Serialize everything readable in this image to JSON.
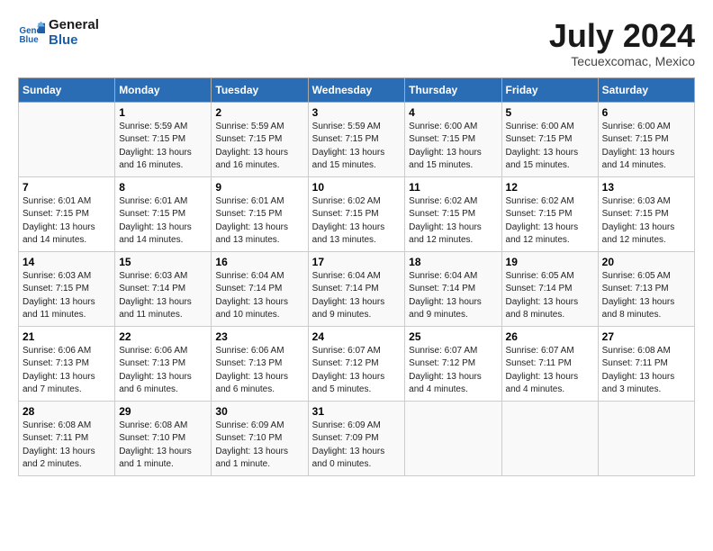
{
  "header": {
    "logo_line1": "General",
    "logo_line2": "Blue",
    "month": "July 2024",
    "location": "Tecuexcomac, Mexico"
  },
  "days_of_week": [
    "Sunday",
    "Monday",
    "Tuesday",
    "Wednesday",
    "Thursday",
    "Friday",
    "Saturday"
  ],
  "weeks": [
    [
      {
        "day": "",
        "info": ""
      },
      {
        "day": "1",
        "info": "Sunrise: 5:59 AM\nSunset: 7:15 PM\nDaylight: 13 hours\nand 16 minutes."
      },
      {
        "day": "2",
        "info": "Sunrise: 5:59 AM\nSunset: 7:15 PM\nDaylight: 13 hours\nand 16 minutes."
      },
      {
        "day": "3",
        "info": "Sunrise: 5:59 AM\nSunset: 7:15 PM\nDaylight: 13 hours\nand 15 minutes."
      },
      {
        "day": "4",
        "info": "Sunrise: 6:00 AM\nSunset: 7:15 PM\nDaylight: 13 hours\nand 15 minutes."
      },
      {
        "day": "5",
        "info": "Sunrise: 6:00 AM\nSunset: 7:15 PM\nDaylight: 13 hours\nand 15 minutes."
      },
      {
        "day": "6",
        "info": "Sunrise: 6:00 AM\nSunset: 7:15 PM\nDaylight: 13 hours\nand 14 minutes."
      }
    ],
    [
      {
        "day": "7",
        "info": "Sunrise: 6:01 AM\nSunset: 7:15 PM\nDaylight: 13 hours\nand 14 minutes."
      },
      {
        "day": "8",
        "info": "Sunrise: 6:01 AM\nSunset: 7:15 PM\nDaylight: 13 hours\nand 14 minutes."
      },
      {
        "day": "9",
        "info": "Sunrise: 6:01 AM\nSunset: 7:15 PM\nDaylight: 13 hours\nand 13 minutes."
      },
      {
        "day": "10",
        "info": "Sunrise: 6:02 AM\nSunset: 7:15 PM\nDaylight: 13 hours\nand 13 minutes."
      },
      {
        "day": "11",
        "info": "Sunrise: 6:02 AM\nSunset: 7:15 PM\nDaylight: 13 hours\nand 12 minutes."
      },
      {
        "day": "12",
        "info": "Sunrise: 6:02 AM\nSunset: 7:15 PM\nDaylight: 13 hours\nand 12 minutes."
      },
      {
        "day": "13",
        "info": "Sunrise: 6:03 AM\nSunset: 7:15 PM\nDaylight: 13 hours\nand 12 minutes."
      }
    ],
    [
      {
        "day": "14",
        "info": "Sunrise: 6:03 AM\nSunset: 7:15 PM\nDaylight: 13 hours\nand 11 minutes."
      },
      {
        "day": "15",
        "info": "Sunrise: 6:03 AM\nSunset: 7:14 PM\nDaylight: 13 hours\nand 11 minutes."
      },
      {
        "day": "16",
        "info": "Sunrise: 6:04 AM\nSunset: 7:14 PM\nDaylight: 13 hours\nand 10 minutes."
      },
      {
        "day": "17",
        "info": "Sunrise: 6:04 AM\nSunset: 7:14 PM\nDaylight: 13 hours\nand 9 minutes."
      },
      {
        "day": "18",
        "info": "Sunrise: 6:04 AM\nSunset: 7:14 PM\nDaylight: 13 hours\nand 9 minutes."
      },
      {
        "day": "19",
        "info": "Sunrise: 6:05 AM\nSunset: 7:14 PM\nDaylight: 13 hours\nand 8 minutes."
      },
      {
        "day": "20",
        "info": "Sunrise: 6:05 AM\nSunset: 7:13 PM\nDaylight: 13 hours\nand 8 minutes."
      }
    ],
    [
      {
        "day": "21",
        "info": "Sunrise: 6:06 AM\nSunset: 7:13 PM\nDaylight: 13 hours\nand 7 minutes."
      },
      {
        "day": "22",
        "info": "Sunrise: 6:06 AM\nSunset: 7:13 PM\nDaylight: 13 hours\nand 6 minutes."
      },
      {
        "day": "23",
        "info": "Sunrise: 6:06 AM\nSunset: 7:13 PM\nDaylight: 13 hours\nand 6 minutes."
      },
      {
        "day": "24",
        "info": "Sunrise: 6:07 AM\nSunset: 7:12 PM\nDaylight: 13 hours\nand 5 minutes."
      },
      {
        "day": "25",
        "info": "Sunrise: 6:07 AM\nSunset: 7:12 PM\nDaylight: 13 hours\nand 4 minutes."
      },
      {
        "day": "26",
        "info": "Sunrise: 6:07 AM\nSunset: 7:11 PM\nDaylight: 13 hours\nand 4 minutes."
      },
      {
        "day": "27",
        "info": "Sunrise: 6:08 AM\nSunset: 7:11 PM\nDaylight: 13 hours\nand 3 minutes."
      }
    ],
    [
      {
        "day": "28",
        "info": "Sunrise: 6:08 AM\nSunset: 7:11 PM\nDaylight: 13 hours\nand 2 minutes."
      },
      {
        "day": "29",
        "info": "Sunrise: 6:08 AM\nSunset: 7:10 PM\nDaylight: 13 hours\nand 1 minute."
      },
      {
        "day": "30",
        "info": "Sunrise: 6:09 AM\nSunset: 7:10 PM\nDaylight: 13 hours\nand 1 minute."
      },
      {
        "day": "31",
        "info": "Sunrise: 6:09 AM\nSunset: 7:09 PM\nDaylight: 13 hours\nand 0 minutes."
      },
      {
        "day": "",
        "info": ""
      },
      {
        "day": "",
        "info": ""
      },
      {
        "day": "",
        "info": ""
      }
    ]
  ]
}
